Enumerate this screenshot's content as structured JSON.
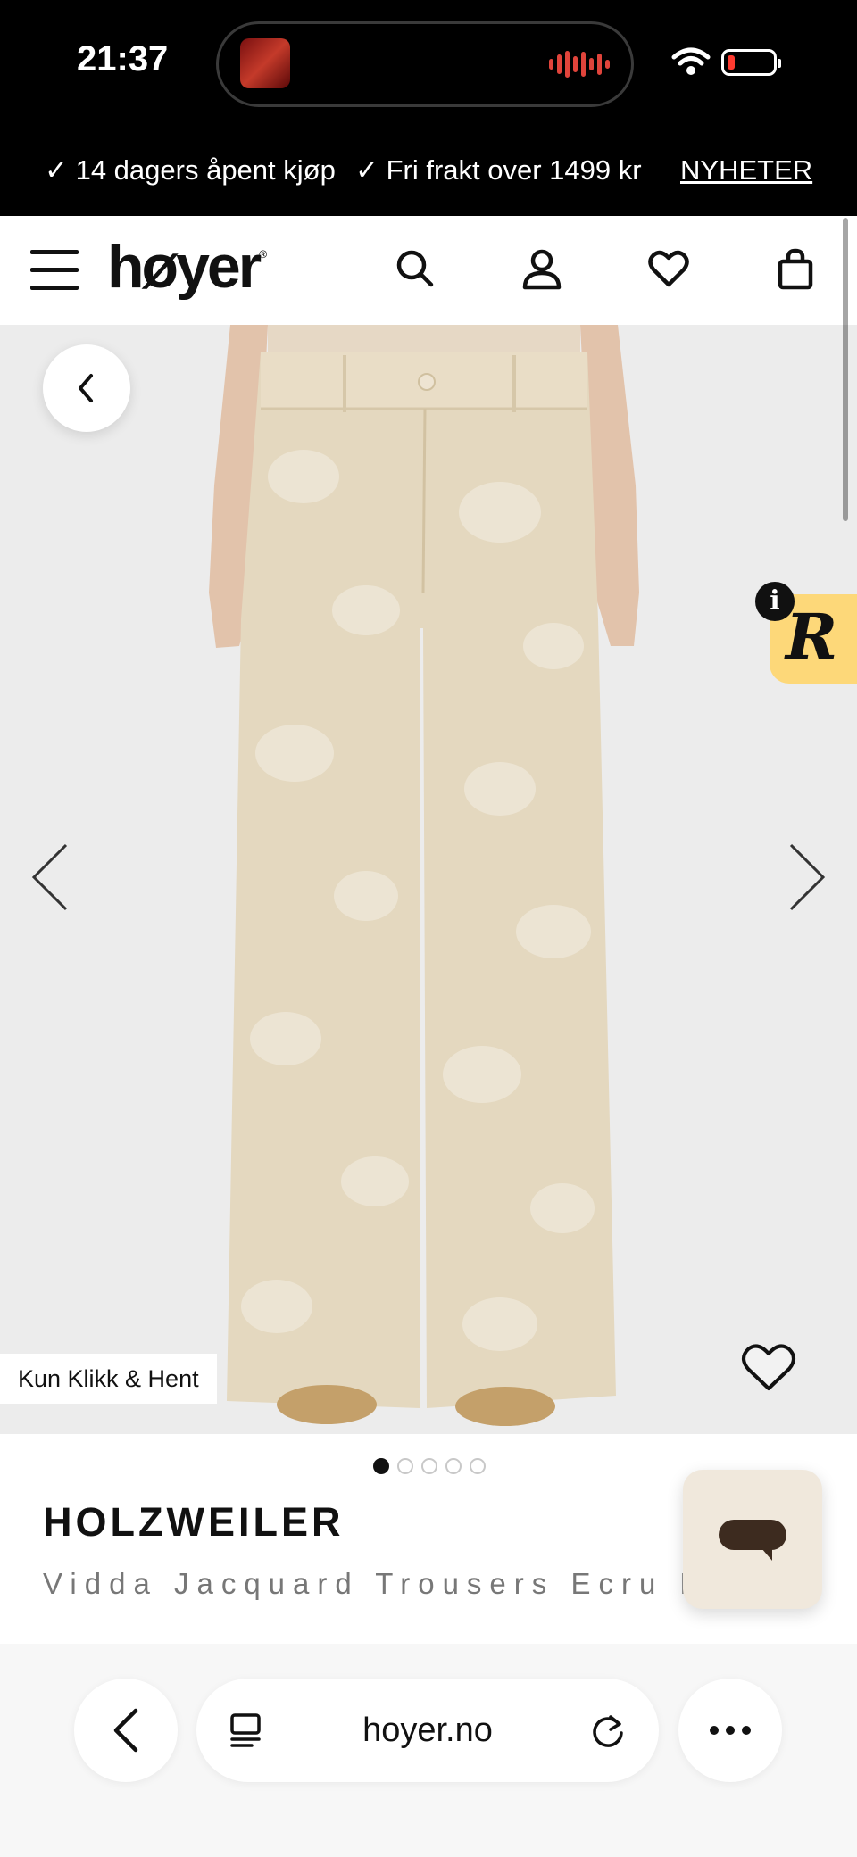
{
  "status_bar": {
    "time": "21:37"
  },
  "promo": {
    "items": [
      "✓ 14 dagers åpent kjøp",
      "✓ Fri frakt over 1499 kr"
    ],
    "link": "NYHETER"
  },
  "header": {
    "logo": "høyer",
    "logo_mark": "®",
    "icons": [
      "menu-icon",
      "search-icon",
      "user-icon",
      "heart-icon",
      "bag-icon"
    ]
  },
  "gallery": {
    "badge": "Kun Klikk & Hent",
    "image_count": 5,
    "active_index": 0,
    "widget_letter": "R",
    "widget_info": "i"
  },
  "product": {
    "brand": "HOLZWEILER",
    "name": "Vidda Jacquard Trousers Ecru Mi"
  },
  "browser": {
    "url": "hoyer.no"
  },
  "colors": {
    "bar_black": "#000000",
    "image_background": "#ececec",
    "fabric": "#e4d8bf",
    "widget_yellow": "#fdd879",
    "chat_beige": "#f0e8dc",
    "chat_brown": "#3d2b1f"
  }
}
